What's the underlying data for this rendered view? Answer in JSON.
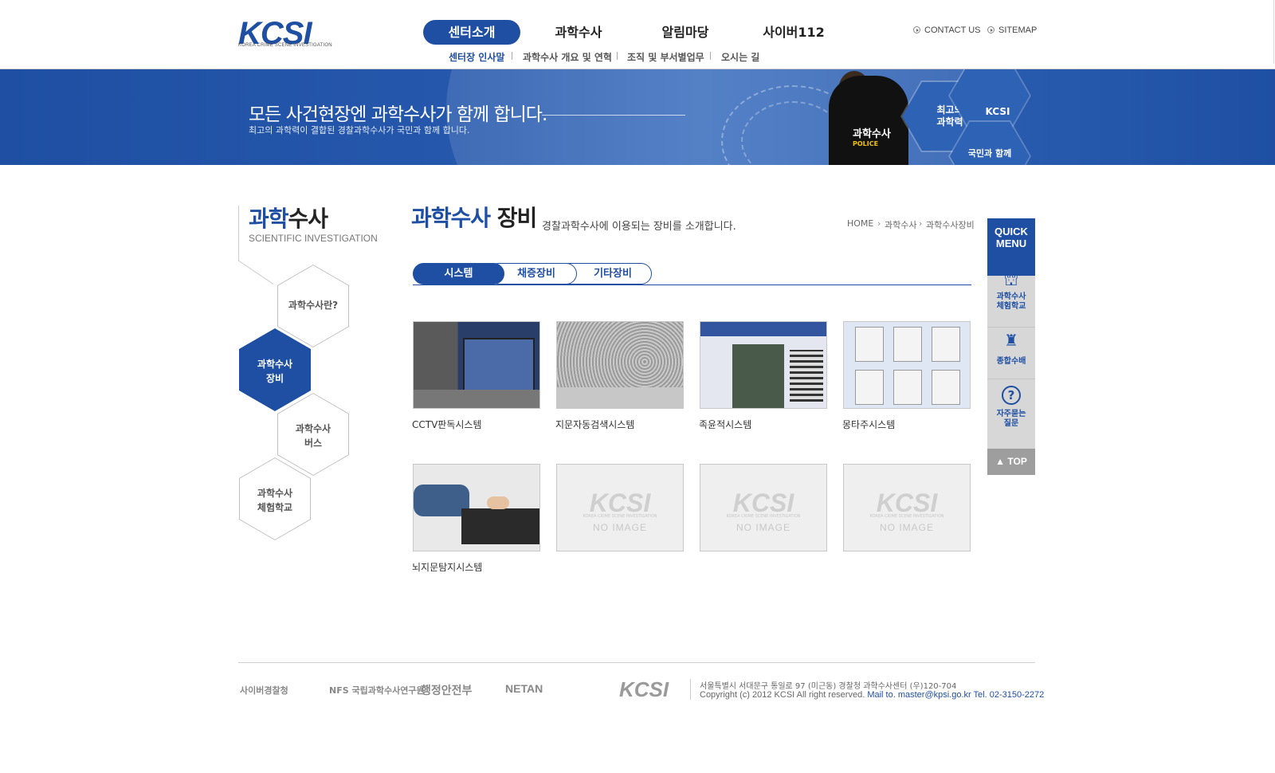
{
  "header": {
    "logo_text": "KCSI",
    "logo_subtext": "KOREA CRIME SCENE INVESTIGATION",
    "gnb": [
      {
        "label": "센터소개"
      },
      {
        "label": "과학수사"
      },
      {
        "label": "알림마당"
      },
      {
        "label": "사이버112"
      }
    ],
    "util": [
      {
        "label": "CONTACT US"
      },
      {
        "label": "SITEMAP"
      }
    ],
    "sub_nav": [
      {
        "label": "센터장 인사말"
      },
      {
        "label": "과학수사 개요 및 연혁"
      },
      {
        "label": "조직 및 부서별업무"
      },
      {
        "label": "오시는 길"
      }
    ]
  },
  "banner": {
    "title": "모든 사건현장엔 과학수사가 함께 합니다.",
    "subtitle": "최고의 과학력이 결합된 경찰과학수사가 국민과 함께 합니다.",
    "officer_text": "과학수사",
    "officer_subtext": "POLICE",
    "hex_badges": [
      {
        "label": "KCSI"
      },
      {
        "label": "최고의\n과학력"
      },
      {
        "label": "국민과 함께"
      }
    ]
  },
  "lnb": {
    "title_highlight": "과학",
    "title_rest": "수사",
    "subtitle": "SCIENTIFIC INVESTIGATION",
    "items": [
      {
        "label": "과학수사란?"
      },
      {
        "label": "과학수사\n장비"
      },
      {
        "label": "과학수사\n버스"
      },
      {
        "label": "과학수사\n체험학교"
      }
    ]
  },
  "content": {
    "title_highlight": "과학수사",
    "title_rest": " 장비",
    "description": "경찰과학수사에 이용되는 장비를 소개합니다.",
    "breadcrumb": [
      "HOME",
      "과학수사",
      "과학수사장비"
    ],
    "tabs": [
      {
        "label": "시스템"
      },
      {
        "label": "채증장비"
      },
      {
        "label": "기타장비"
      }
    ],
    "items": [
      {
        "label": "CCTV판독시스템"
      },
      {
        "label": "지문자동검색시스템"
      },
      {
        "label": "족윤적시스템"
      },
      {
        "label": "몽타주시스템"
      },
      {
        "label": "뇌지문탐지시스템"
      }
    ],
    "no_image": {
      "logo": "KCSI",
      "sub": "KOREA CRIME SCENE INVESTIGATION",
      "text": "NO IMAGE"
    }
  },
  "quick_menu": {
    "title": "QUICK\nMENU",
    "items": [
      {
        "label": "과학수사\n체험학교"
      },
      {
        "label": "종합수배"
      },
      {
        "label": "자주묻는\n질문"
      }
    ],
    "top": "▲ TOP"
  },
  "footer": {
    "partners": [
      "사이버경찰청",
      "NFS 국립과학수사연구원",
      "행정안전부",
      "NETAN"
    ],
    "logo": "KCSI",
    "address": "서울특별시 서대문구 통일로 97 (미근동) 경찰청 과학수사센터 (우)120-704",
    "copyright": "Copyright (c) 2012 KCSI All right reserved.",
    "contact": "Mail to. master@kpsi.go.kr Tel. 02-3150-2272"
  },
  "colors": {
    "accent": "#1e4fa3",
    "banner": "#2557ac"
  }
}
